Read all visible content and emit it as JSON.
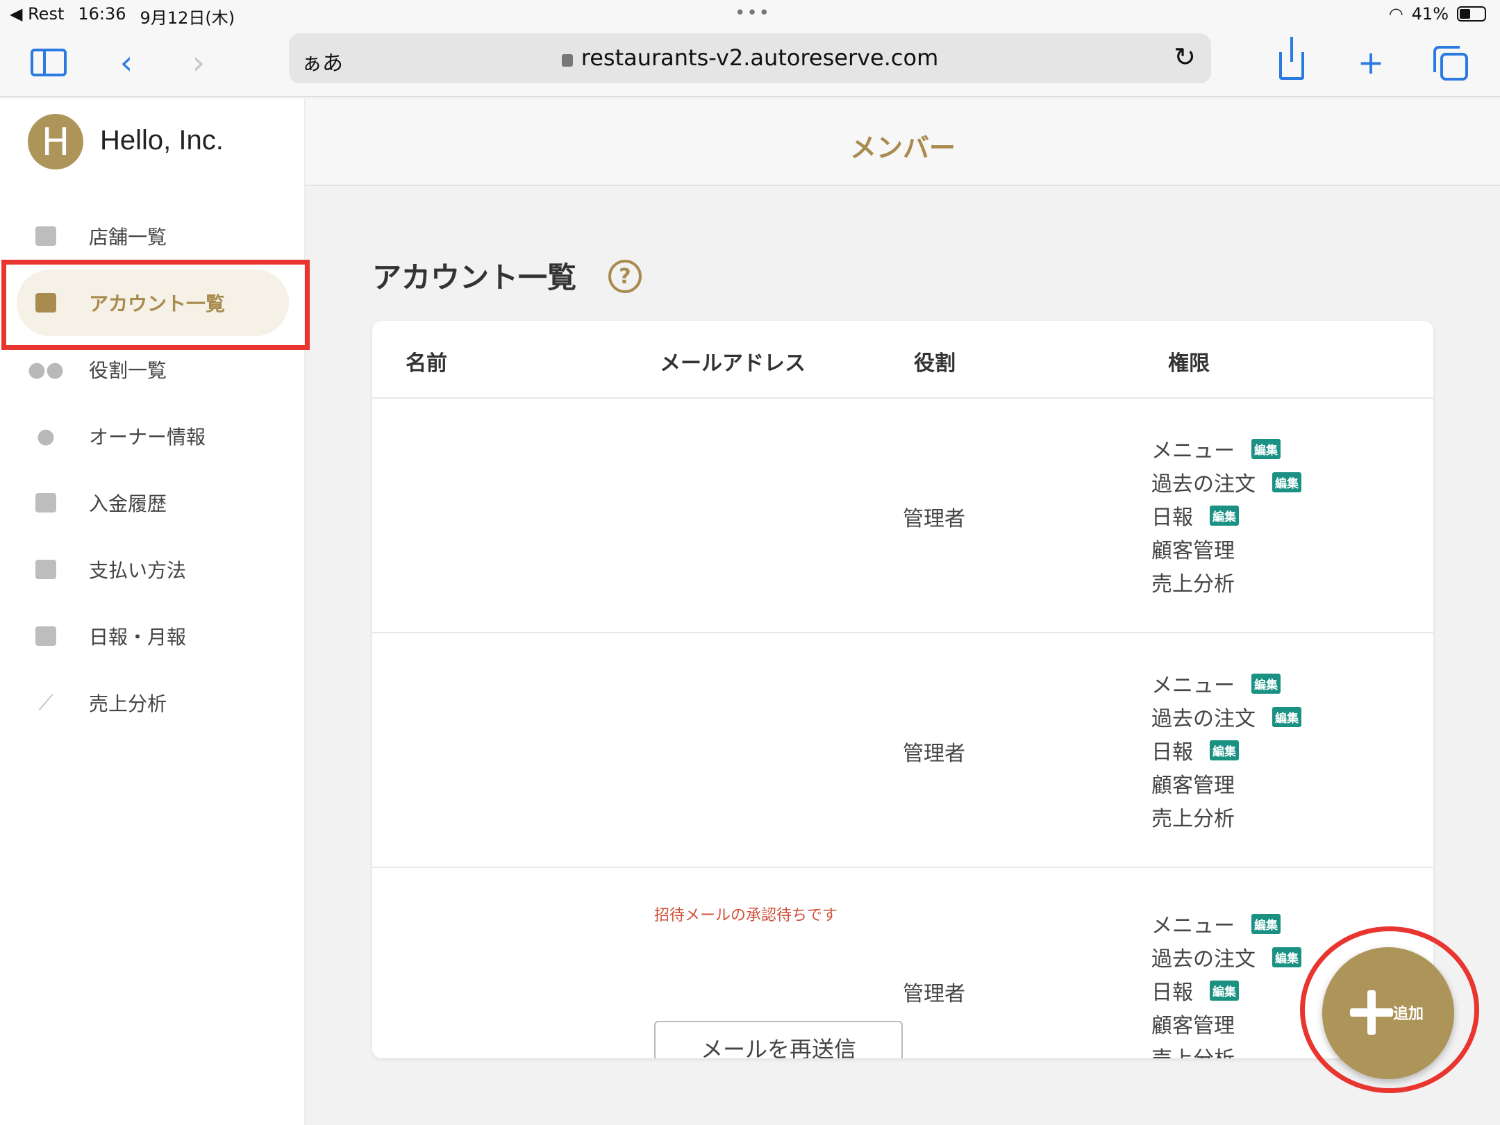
{
  "status_bar": {
    "back_app": "◀ Rest",
    "time": "16:36",
    "date": "9月12日(木)",
    "battery": "41%"
  },
  "browser": {
    "aa_label": "ぁあ",
    "url": "restaurants-v2.autoreserve.com"
  },
  "header": {
    "avatar_letter": "H",
    "company": "Hello, Inc.",
    "page_title": "メンバー"
  },
  "sidebar": {
    "items": [
      {
        "label": "店舗一覧",
        "icon": "calendar-icon"
      },
      {
        "label": "アカウント一覧",
        "icon": "id-card-icon",
        "active": true
      },
      {
        "label": "役割一覧",
        "icon": "users-icon"
      },
      {
        "label": "オーナー情報",
        "icon": "owner-icon"
      },
      {
        "label": "入金履歴",
        "icon": "money-icon"
      },
      {
        "label": "支払い方法",
        "icon": "credit-card-icon"
      },
      {
        "label": "日報・月報",
        "icon": "clipboard-icon"
      },
      {
        "label": "売上分析",
        "icon": "chart-icon"
      }
    ]
  },
  "main": {
    "section_title": "アカウント一覧",
    "help": "?",
    "columns": [
      "名前",
      "メールアドレス",
      "役割",
      "権限"
    ],
    "rows": [
      {
        "role": "管理者",
        "permissions": [
          {
            "label": "メニュー",
            "badge": "編集"
          },
          {
            "label": "過去の注文",
            "badge": "編集"
          },
          {
            "label": "日報",
            "badge": "編集"
          },
          {
            "label": "顧客管理",
            "badge": ""
          },
          {
            "label": "売上分析",
            "badge": ""
          }
        ]
      },
      {
        "role": "管理者",
        "permissions": [
          {
            "label": "メニュー",
            "badge": "編集"
          },
          {
            "label": "過去の注文",
            "badge": "編集"
          },
          {
            "label": "日報",
            "badge": "編集"
          },
          {
            "label": "顧客管理",
            "badge": ""
          },
          {
            "label": "売上分析",
            "badge": ""
          }
        ]
      },
      {
        "role": "管理者",
        "pending_text": "招待メールの承認待ちです",
        "resend_label": "メールを再送信",
        "permissions": [
          {
            "label": "メニュー",
            "badge": "編集"
          },
          {
            "label": "過去の注文",
            "badge": "編集"
          },
          {
            "label": "日報",
            "badge": "編集"
          },
          {
            "label": "顧客管理",
            "badge": ""
          },
          {
            "label": "売上分析",
            "badge": ""
          }
        ]
      }
    ],
    "add_label": "追加"
  },
  "colors": {
    "accent": "#ad9459",
    "badge": "#1a9183",
    "highlight": "#e8352f"
  }
}
